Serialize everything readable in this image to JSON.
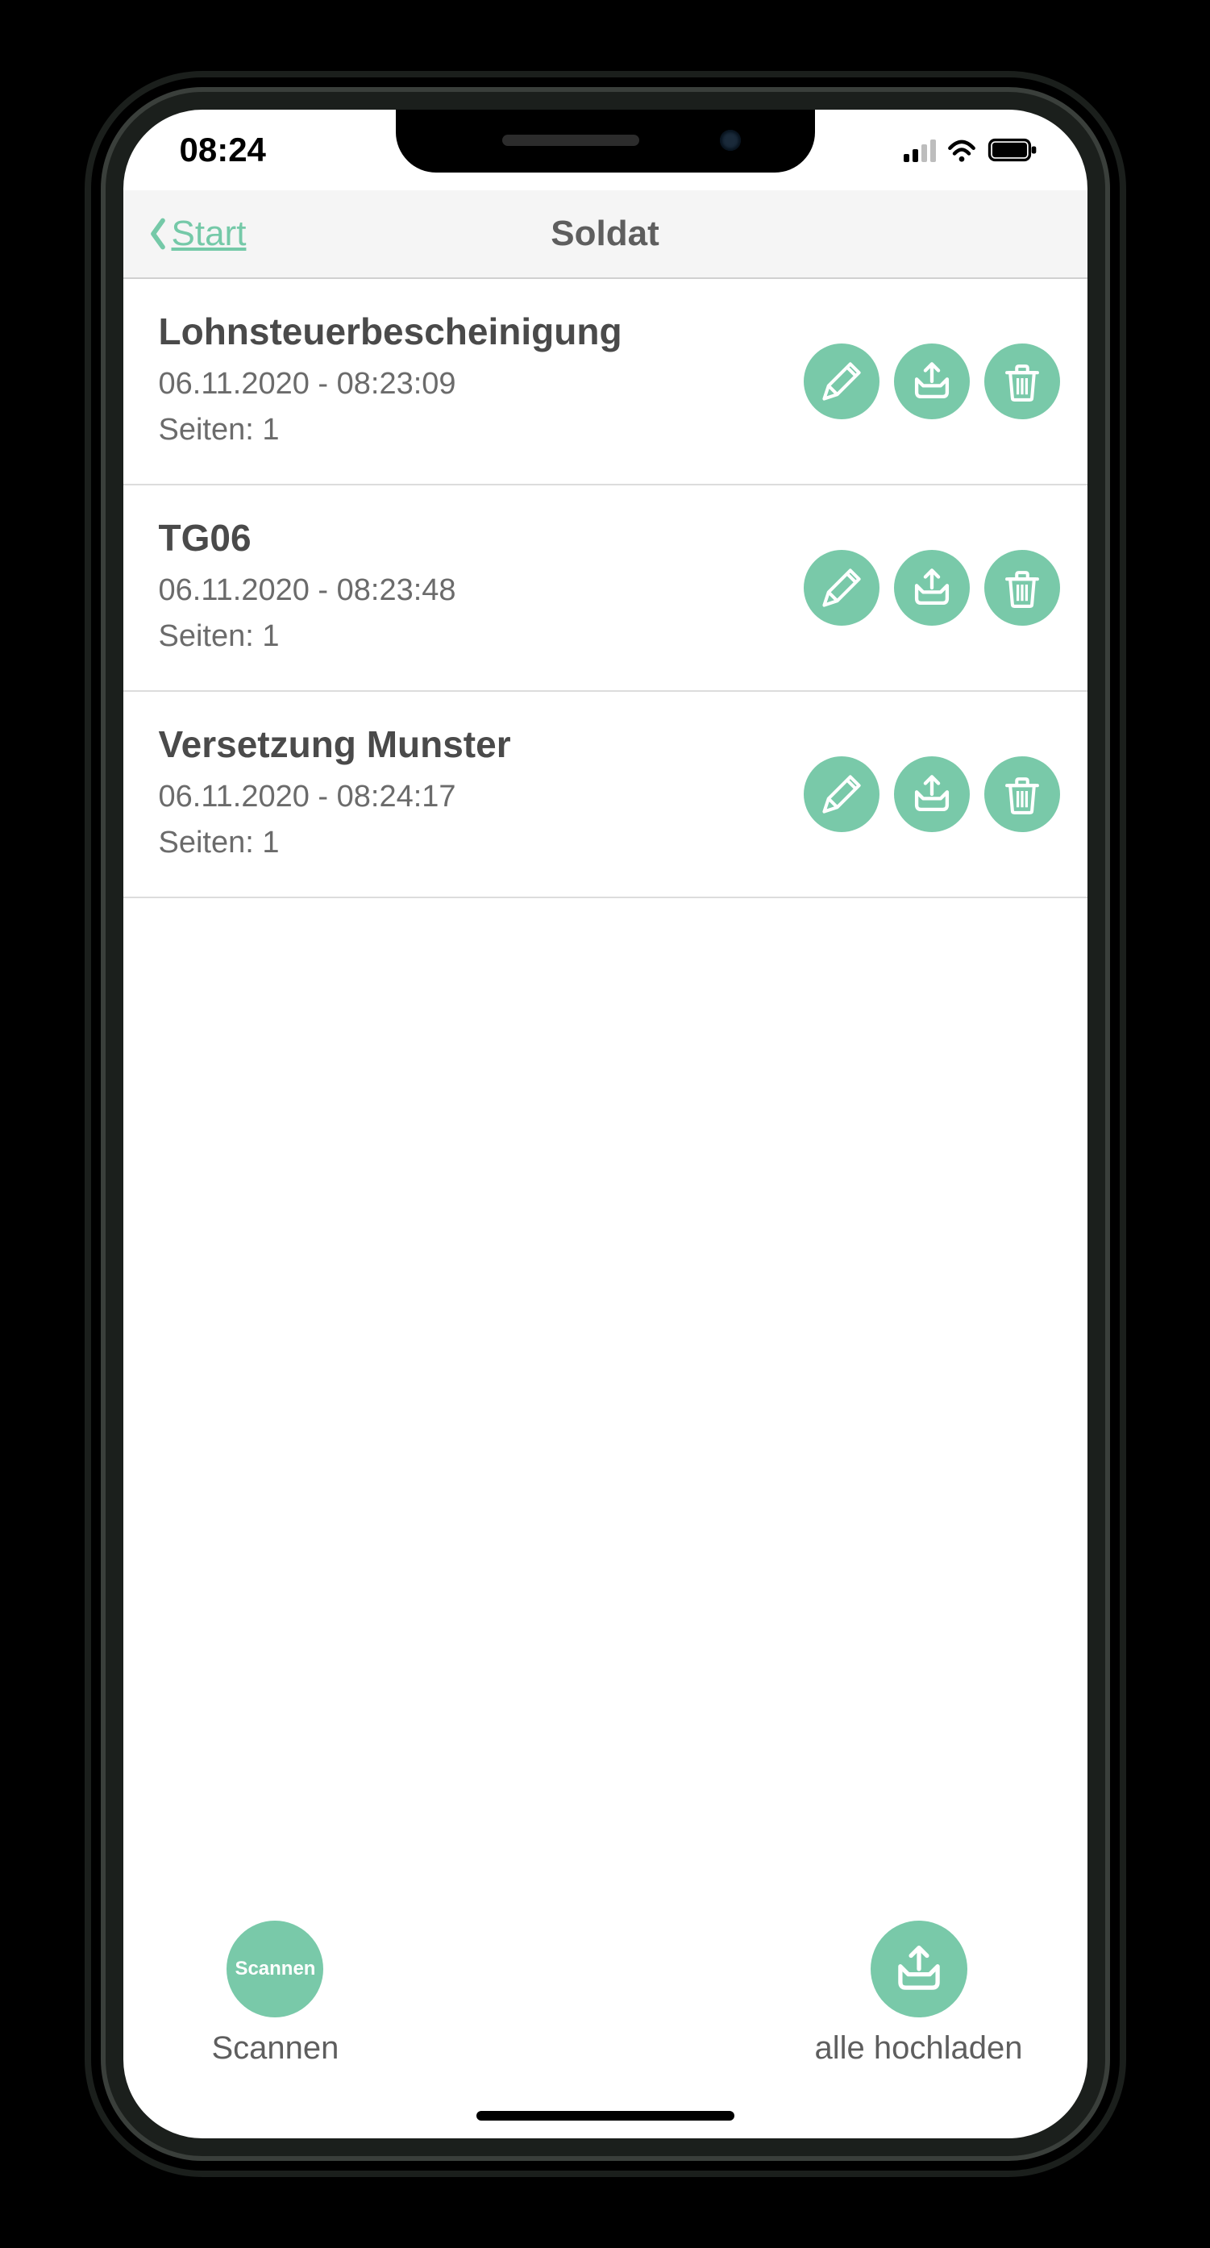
{
  "colors": {
    "accent": "#79c9a9",
    "link": "#75c9a8"
  },
  "status": {
    "time": "08:24"
  },
  "nav": {
    "back_label": "Start",
    "title": "Soldat"
  },
  "pages_prefix": "Seiten: ",
  "documents": [
    {
      "title": "Lohnsteuerbescheinigung",
      "timestamp": "06.11.2020 - 08:23:09",
      "pages": "1"
    },
    {
      "title": "TG06",
      "timestamp": "06.11.2020 - 08:23:48",
      "pages": "1"
    },
    {
      "title": "Versetzung Munster",
      "timestamp": "06.11.2020 - 08:24:17",
      "pages": "1"
    }
  ],
  "footer": {
    "scan": {
      "button_text": "Scannen",
      "caption": "Scannen"
    },
    "upload": {
      "caption": "alle hochladen"
    }
  }
}
